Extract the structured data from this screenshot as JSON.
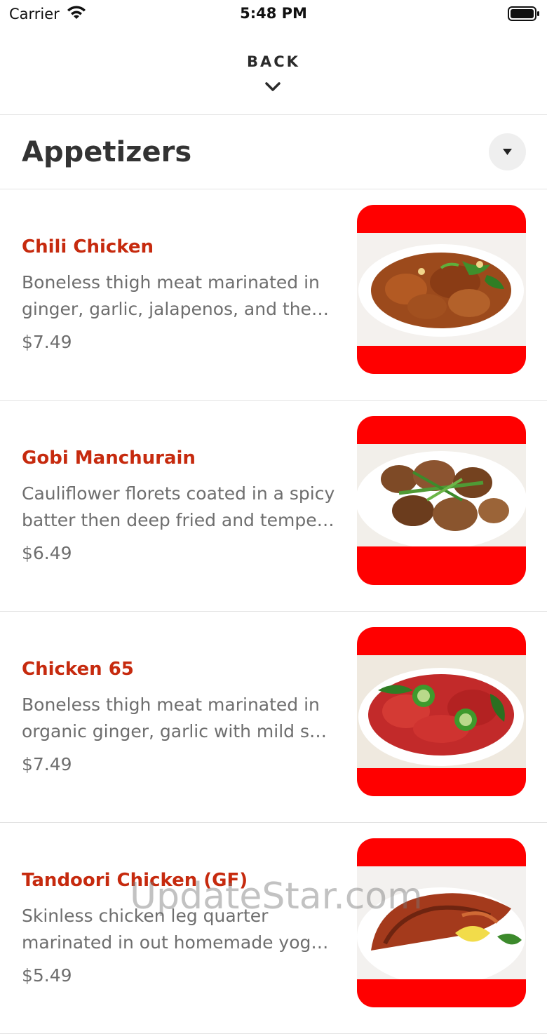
{
  "status_bar": {
    "carrier": "Carrier",
    "time": "5:48 PM"
  },
  "back": {
    "label": "BACK"
  },
  "category": {
    "title": "Appetizers"
  },
  "colors": {
    "item_name": "#c62a0e",
    "photo_frame": "#ff0000",
    "text_muted": "#6e6e6e"
  },
  "items": [
    {
      "name": "Chili Chicken",
      "desc_line1": "Boneless thigh meat marinated in",
      "desc_line2": "ginger, garlic, jalapenos, and then…",
      "price": "$7.49",
      "photo_icon": "chili-chicken-photo"
    },
    {
      "name": "Gobi Manchurain",
      "desc_line1": "Cauliflower florets coated in a spicy",
      "desc_line2": "batter then deep fried and temper…",
      "price": "$6.49",
      "photo_icon": "gobi-manchurian-photo"
    },
    {
      "name": "Chicken 65",
      "desc_line1": "Boneless thigh meat marinated in",
      "desc_line2": "organic ginger, garlic with mild spi…",
      "price": "$7.49",
      "photo_icon": "chicken-65-photo"
    },
    {
      "name": "Tandoori Chicken (GF)",
      "desc_line1": "Skinless chicken leg quarter",
      "desc_line2": "marinated in out homemade yogur…",
      "price": "$5.49",
      "photo_icon": "tandoori-chicken-photo"
    }
  ],
  "watermark": "UpdateStar.com"
}
